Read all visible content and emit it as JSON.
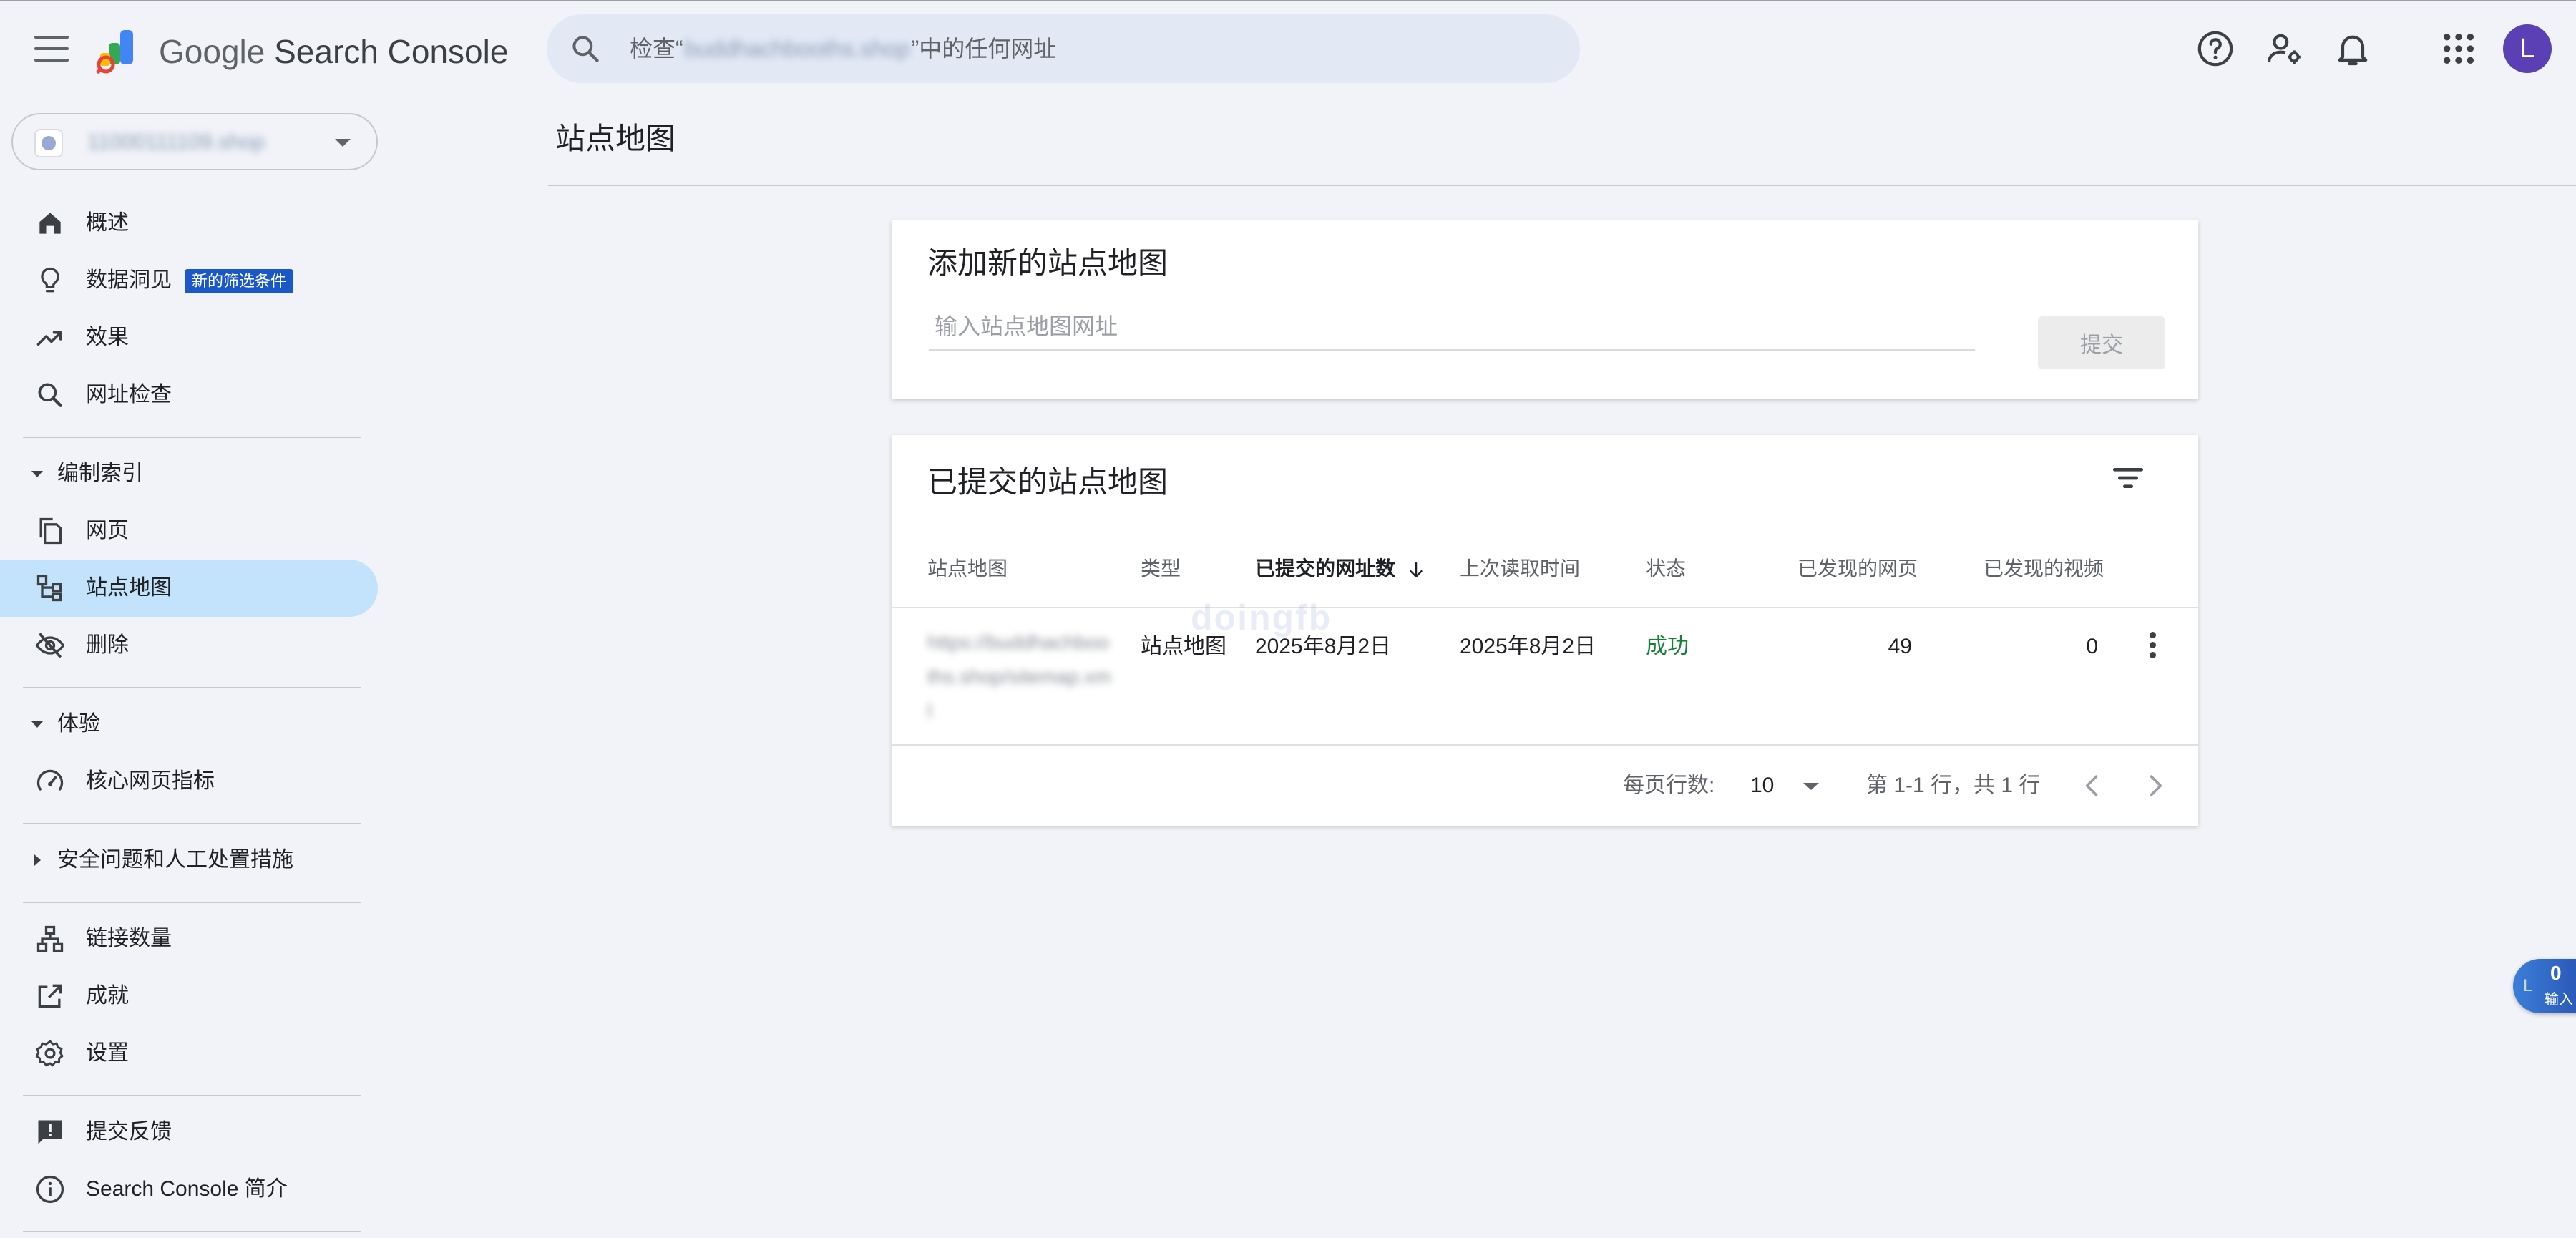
{
  "header": {
    "product_brand": "Google",
    "product_name": "Search Console",
    "search": {
      "prefix": "检查“",
      "blurred_domain": "buddhachbooths.shop",
      "suffix": "”中的任何网址"
    },
    "avatar_letter": "L",
    "icons": [
      "menu-icon",
      "help-icon",
      "manage-users-icon",
      "notifications-icon",
      "apps-icon"
    ]
  },
  "sidebar": {
    "property": {
      "blurred_name": "11000111109.shop"
    },
    "items": [
      {
        "label": "概述",
        "icon": "home-icon"
      },
      {
        "label": "数据洞见",
        "icon": "lightbulb-icon",
        "badge": "新的筛选条件"
      },
      {
        "label": "效果",
        "icon": "trending-up-icon"
      },
      {
        "label": "网址检查",
        "icon": "search-icon"
      }
    ],
    "sections": [
      {
        "title": "编制索引",
        "items": [
          {
            "label": "网页",
            "icon": "pages-icon"
          },
          {
            "label": "站点地图",
            "icon": "sitemap-icon",
            "active": true
          },
          {
            "label": "删除",
            "icon": "visibility-off-icon"
          }
        ]
      },
      {
        "title": "体验",
        "items": [
          {
            "label": "核心网页指标",
            "icon": "speed-icon"
          }
        ]
      },
      {
        "title": "安全问题和人工处置措施",
        "collapsed": true
      }
    ],
    "more_items": [
      {
        "label": "链接数量",
        "icon": "links-icon"
      },
      {
        "label": "成就",
        "icon": "open-external-icon"
      },
      {
        "label": "设置",
        "icon": "settings-icon"
      }
    ],
    "footer_items": [
      {
        "label": "提交反馈",
        "icon": "feedback-icon"
      },
      {
        "label": "Search Console 简介",
        "icon": "info-icon"
      }
    ]
  },
  "main": {
    "page_title": "站点地图",
    "add_card": {
      "title": "添加新的站点地图",
      "input_placeholder": "输入站点地图网址",
      "submit_label": "提交"
    },
    "submitted_card": {
      "title": "已提交的站点地图",
      "columns": [
        "站点地图",
        "类型",
        "已提交的网址数",
        "上次读取时间",
        "状态",
        "已发现的网页",
        "已发现的视频"
      ],
      "sorted_column": "已提交的网址数",
      "rows": [
        {
          "sitemap_blurred": [
            "https://buddhachboo",
            "ths.shop/sitemap.xm",
            "l"
          ],
          "type": "站点地图",
          "submitted": "2025年8月2日",
          "last_read": "2025年8月2日",
          "status": "成功",
          "pages": "49",
          "videos": "0"
        }
      ],
      "pagination": {
        "rows_per_page_label": "每页行数:",
        "rows_per_page": "10",
        "range_text": "第 1-1 行，共 1 行"
      }
    }
  },
  "watermark": "doingfb",
  "floating_widget": {
    "letter": "L",
    "count": "0",
    "label": "输入"
  },
  "colors": {
    "background": "#f1f3f8",
    "search_bg": "#e2e9f5",
    "active_nav": "#c2e3fb",
    "badge": "#1a57c9",
    "success": "#188038",
    "avatar": "#5b3fb4"
  }
}
